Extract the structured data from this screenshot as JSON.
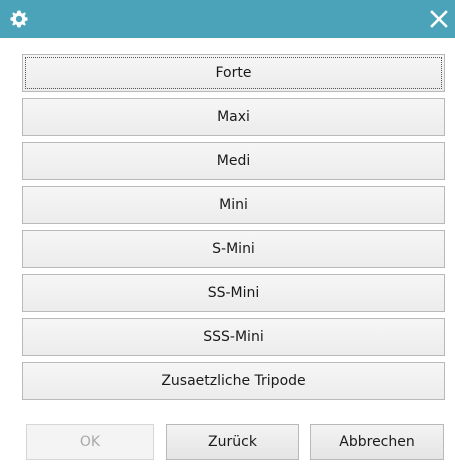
{
  "titlebar": {
    "icon": "gear-icon",
    "close_icon": "close-icon",
    "color": "#4aa3b9"
  },
  "options": [
    {
      "label": "Forte"
    },
    {
      "label": "Maxi"
    },
    {
      "label": "Medi"
    },
    {
      "label": "Mini"
    },
    {
      "label": "S-Mini"
    },
    {
      "label": "SS-Mini"
    },
    {
      "label": "SSS-Mini"
    },
    {
      "label": "Zusaetzliche Tripode"
    }
  ],
  "footer": {
    "ok_label": "OK",
    "back_label": "Zurück",
    "cancel_label": "Abbrechen"
  }
}
